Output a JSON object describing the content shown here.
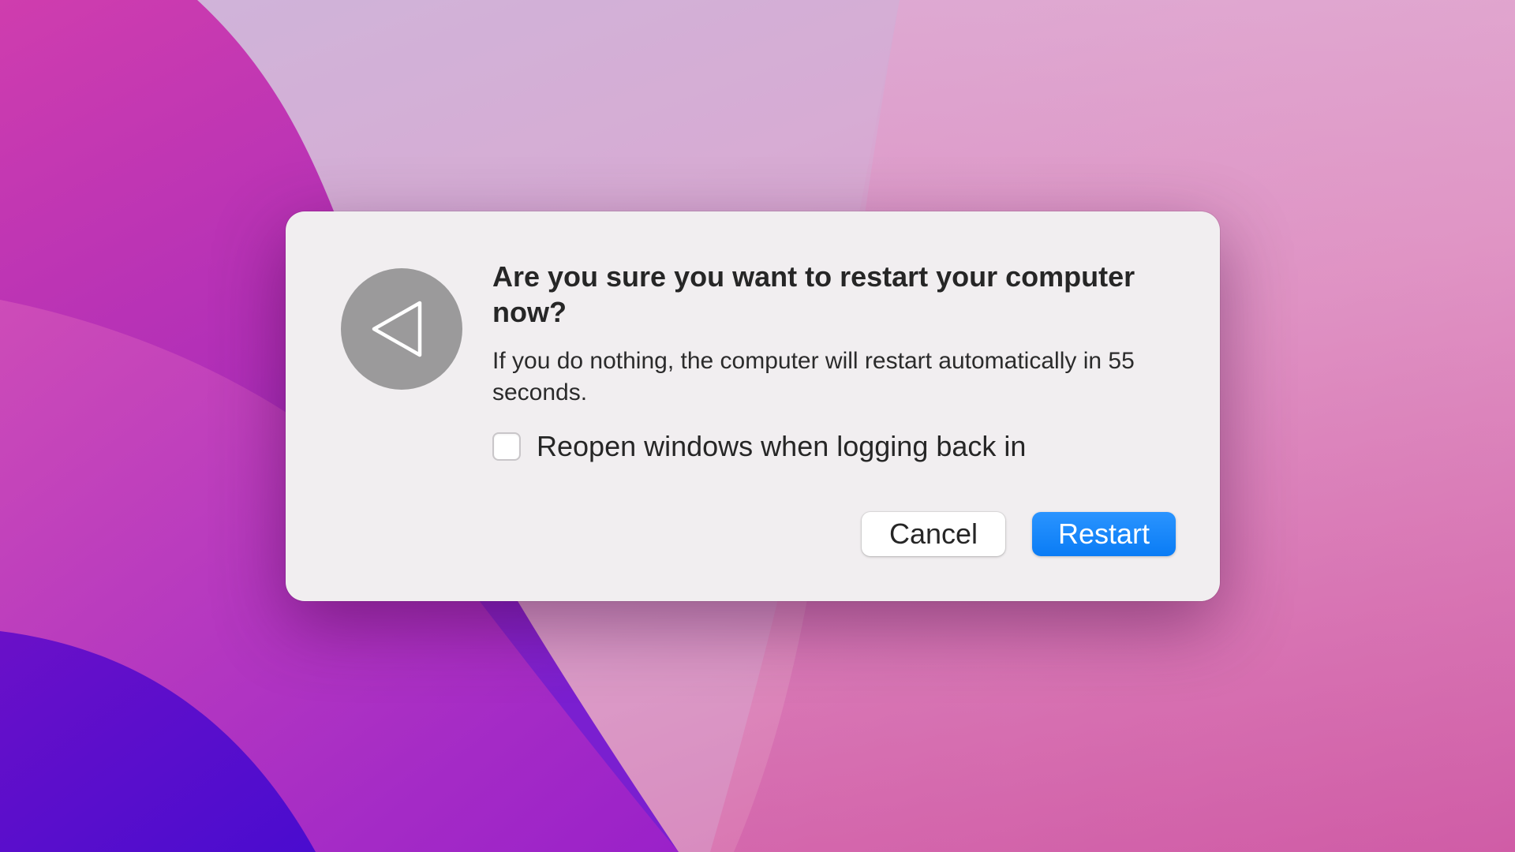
{
  "dialog": {
    "icon": "back-triangle-icon",
    "title": "Are you sure you want to restart your computer now?",
    "message": "If you do nothing, the computer will restart automatically in 55 seconds.",
    "checkbox": {
      "label": "Reopen windows when logging back in",
      "checked": false
    },
    "buttons": {
      "cancel_label": "Cancel",
      "restart_label": "Restart"
    }
  },
  "colors": {
    "dialog_background": "#f1eef0",
    "icon_circle": "#9b9a9b",
    "primary_button": "#0a7cf5",
    "text": "#262626"
  }
}
